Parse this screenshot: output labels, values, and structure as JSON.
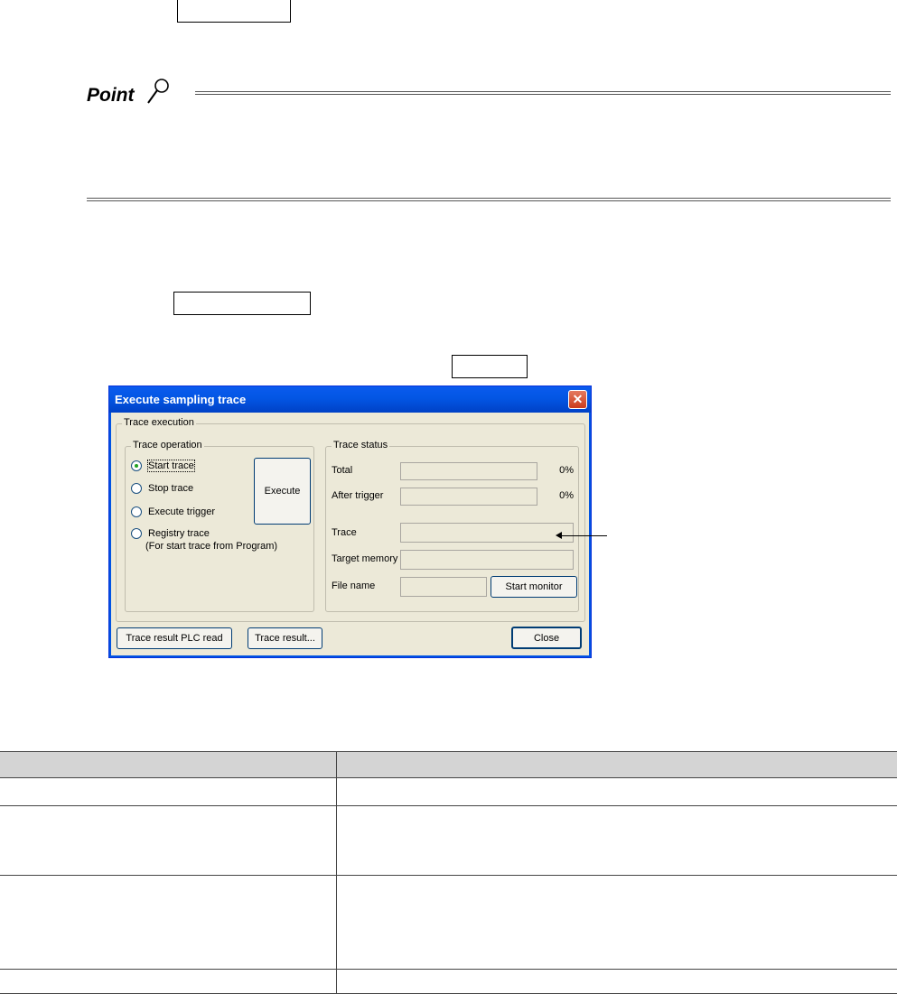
{
  "point_label": "Point",
  "dialog": {
    "title": "Execute sampling trace",
    "close_icon": "close-x-icon",
    "trace_execution_label": "Trace execution",
    "trace_operation": {
      "label": "Trace operation",
      "options": [
        {
          "label": "Start trace",
          "checked": true
        },
        {
          "label": "Stop trace",
          "checked": false
        },
        {
          "label": "Execute trigger",
          "checked": false
        },
        {
          "label": "Registry trace",
          "checked": false
        }
      ],
      "registry_note": "(For start trace from Program)",
      "execute_button": "Execute"
    },
    "trace_status": {
      "label": "Trace status",
      "total_label": "Total",
      "total_pct": "0%",
      "after_trigger_label": "After trigger",
      "after_trigger_pct": "0%",
      "trace_label": "Trace",
      "target_memory_label": "Target memory",
      "file_name_label": "File name",
      "start_monitor_button": "Start monitor"
    },
    "buttons": {
      "plc_read": "Trace result PLC read",
      "trace_result": "Trace result...",
      "close": "Close"
    }
  }
}
